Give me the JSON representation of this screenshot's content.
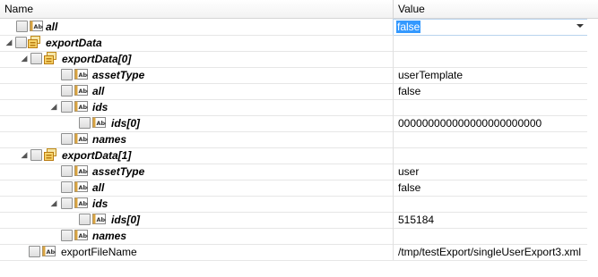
{
  "header": {
    "name": "Name",
    "value": "Value"
  },
  "rows": [
    {
      "label": "all",
      "value": "false"
    },
    {
      "label": "exportData",
      "value": ""
    },
    {
      "label": "exportData[0]",
      "value": ""
    },
    {
      "label": "assetType",
      "value": "userTemplate"
    },
    {
      "label": "all",
      "value": "false"
    },
    {
      "label": "ids",
      "value": ""
    },
    {
      "label": "ids[0]",
      "value": "000000000000000000000000"
    },
    {
      "label": "names",
      "value": ""
    },
    {
      "label": "exportData[1]",
      "value": ""
    },
    {
      "label": "assetType",
      "value": "user"
    },
    {
      "label": "all",
      "value": "false"
    },
    {
      "label": "ids",
      "value": ""
    },
    {
      "label": "ids[0]",
      "value": "515184"
    },
    {
      "label": "names",
      "value": ""
    },
    {
      "label": "exportFileName",
      "value": "/tmp/testExport/singleUserExport3.xml"
    }
  ],
  "icons": {
    "text": "abc-text-icon",
    "object": "object-node-icon",
    "array": "array-node-icon"
  }
}
